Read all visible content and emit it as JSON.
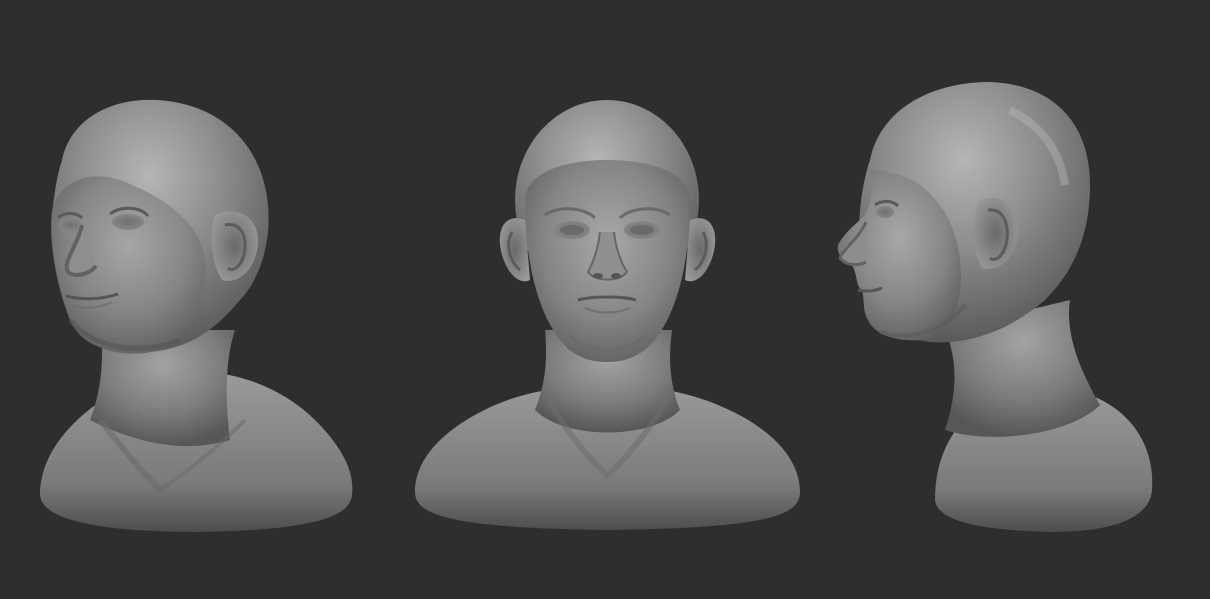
{
  "scene": {
    "background_color": "#2e2e2e",
    "material_color": "#8a8a8a",
    "views": [
      {
        "view": "three-quarter-left"
      },
      {
        "view": "front"
      },
      {
        "view": "profile-left"
      }
    ]
  }
}
